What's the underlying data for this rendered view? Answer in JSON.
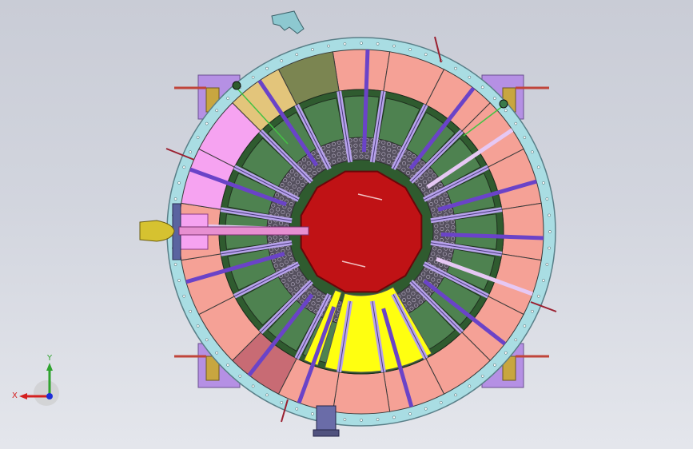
{
  "viewport": {
    "background_top": "#c9ccd6",
    "background_bottom": "#e4e6ec"
  },
  "model": {
    "colors": {
      "outer_flange": "#a9dde3",
      "outer_flange_stroke": "#5a7f88",
      "bolt": "#ffffff",
      "segment_salmon": "#f5a196",
      "segment_olive": "#7b8551",
      "segment_tan": "#e3c57b",
      "segment_pink": "#f6a3f1",
      "segment_rose": "#c86b74",
      "inner_ring_dark": "#2f5b2f",
      "inner_green": "#4e8250",
      "spoke_lavender": "#b8a3ec",
      "spoke_purple": "#6a43c8",
      "honeycomb": "#55505e",
      "core_red": "#c01215",
      "core_stroke": "#6b0508",
      "yellow": "#ffff10",
      "shaft_pink": "#e78fd1",
      "nozzle_gold": "#d6c230",
      "bracket_purple": "#b590e4",
      "bracket_gold": "#c8a640",
      "pin_red": "#c0453a",
      "motor_blue": "#6a6ca8"
    },
    "segment_layout": [
      "salmon",
      "salmon",
      "salmon",
      "salmon",
      "salmon",
      "salmon",
      "salmon",
      "salmon",
      "salmon",
      "salmon",
      "salmon",
      "salmon",
      "rose",
      "salmon",
      "salmon",
      "salmon",
      "pink",
      "pink",
      "tan",
      "olive"
    ],
    "purple_rod_indices": [
      0,
      2,
      4,
      5,
      7,
      9,
      11,
      12,
      14,
      16,
      18
    ],
    "lavender_rod_indices": [
      3,
      6,
      15
    ]
  },
  "triad": {
    "x_label": "X",
    "y_label": "Y",
    "x_color": "#d42020",
    "y_color": "#2fa32f",
    "z_color": "#1c2dd8"
  }
}
